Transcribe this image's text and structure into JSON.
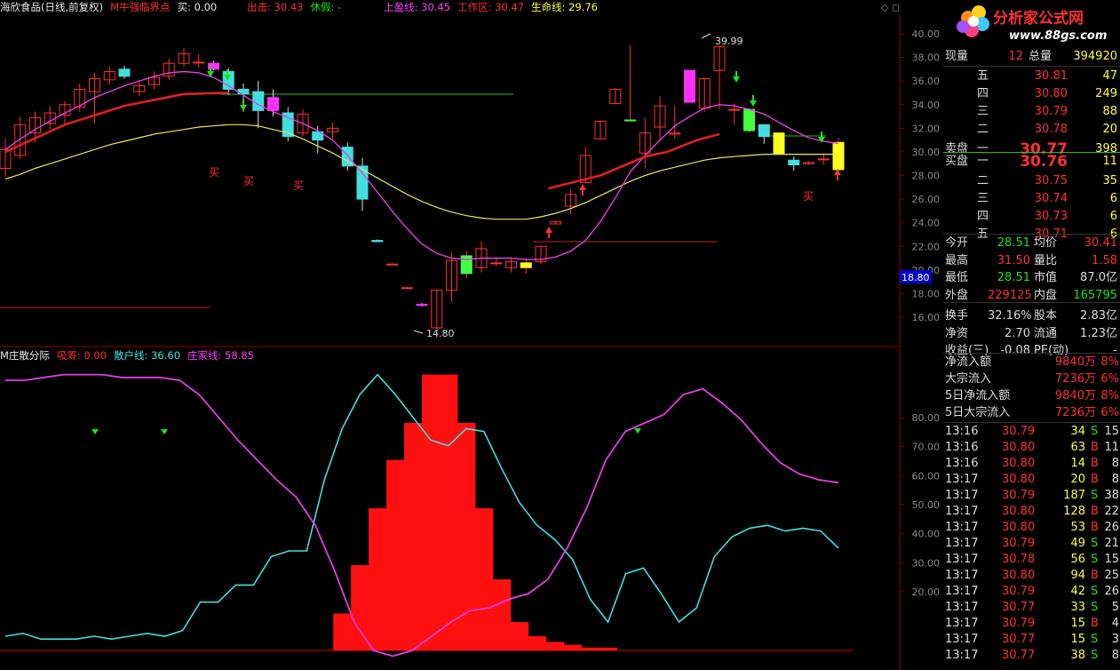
{
  "header": {
    "stock": "海欣食品(日线,前复权)",
    "indicator": "M牛强临界点",
    "buy": "买: 0.00",
    "sell_out": "出击: 30.43",
    "rest": "休假: -",
    "upper": "上盈线: 30.45",
    "work": "工作区: 30.47",
    "life": "生命线: 29.76"
  },
  "sub_header": {
    "name": "M庄散分际",
    "absorb": "吸筹: 0.00",
    "retail": "散户线: 36.60",
    "dealer": "庄家线: 58.85"
  },
  "logo": {
    "title": "分析家公式网",
    "url": "www.88gs.com"
  },
  "chart_data": [
    {
      "type": "candlestick",
      "yaxis_ticks": [
        "40.00",
        "38.00",
        "36.00",
        "34.00",
        "32.00",
        "30.00",
        "28.00",
        "26.00",
        "24.00",
        "22.00",
        "20.00",
        "18.00",
        "16.00"
      ],
      "ylim": [
        14.5,
        41
      ],
      "cursor_label": "18.80",
      "max_label": "39.99",
      "min_label": "14.80",
      "buy_labels": [
        "买",
        "买",
        "买",
        "买"
      ],
      "candles": [
        [
          28.6,
          31.1,
          27.9,
          30.2
        ],
        [
          29.7,
          33.0,
          29.4,
          32.3
        ],
        [
          31.6,
          33.4,
          30.8,
          32.9
        ],
        [
          32.4,
          33.9,
          31.9,
          33.3
        ],
        [
          33.1,
          34.3,
          32.4,
          34.0
        ],
        [
          33.8,
          35.8,
          33.4,
          35.3
        ],
        [
          35.1,
          36.7,
          32.4,
          36.2
        ],
        [
          36.1,
          37.2,
          35.7,
          36.8
        ],
        [
          37.0,
          37.3,
          36.2,
          36.4
        ],
        [
          35.1,
          35.9,
          34.7,
          35.6
        ],
        [
          35.7,
          36.8,
          35.3,
          36.3
        ],
        [
          36.4,
          37.9,
          36.1,
          37.5
        ],
        [
          37.5,
          38.8,
          37.2,
          38.3
        ],
        [
          37.6,
          38.3,
          37.1,
          37.6
        ],
        [
          37.5,
          37.7,
          36.9,
          37.0
        ],
        [
          36.8,
          37.1,
          34.8,
          35.3
        ],
        [
          35.3,
          35.8,
          33.4,
          34.9
        ],
        [
          35.1,
          36.0,
          32.0,
          33.5
        ],
        [
          34.6,
          35.3,
          33.0,
          33.5
        ],
        [
          33.3,
          33.8,
          30.9,
          31.3
        ],
        [
          31.6,
          33.6,
          31.3,
          33.2
        ],
        [
          31.7,
          32.2,
          29.9,
          31.0
        ],
        [
          31.7,
          32.5,
          31.1,
          32.0
        ],
        [
          30.4,
          30.8,
          28.4,
          28.8
        ],
        [
          28.8,
          29.5,
          25.0,
          26.0
        ],
        [
          22.5,
          22.6,
          22.4,
          22.4
        ],
        [
          20.5,
          20.6,
          20.4,
          20.5
        ],
        [
          18.5,
          18.6,
          18.4,
          18.5
        ],
        [
          17.1,
          17.2,
          16.9,
          17.0
        ],
        [
          15.1,
          18.3,
          14.8,
          18.3
        ],
        [
          18.3,
          21.5,
          17.3,
          20.8
        ],
        [
          19.7,
          21.6,
          19.3,
          21.2
        ],
        [
          20.2,
          22.4,
          19.8,
          21.8
        ],
        [
          20.6,
          21.1,
          20.3,
          20.6
        ],
        [
          20.2,
          21.0,
          19.8,
          20.7
        ],
        [
          20.2,
          21.0,
          19.7,
          20.6
        ],
        [
          20.7,
          22.0,
          20.5,
          22.0
        ],
        [
          23.9,
          24.1,
          23.9,
          24.1
        ],
        [
          25.4,
          26.8,
          24.7,
          26.4
        ],
        [
          27.4,
          30.4,
          27.4,
          29.7
        ],
        [
          31.1,
          32.6,
          31.1,
          32.6
        ],
        [
          34.1,
          35.4,
          34.1,
          35.3
        ],
        [
          32.7,
          39.0,
          32.7,
          32.7
        ],
        [
          29.9,
          32.9,
          28.6,
          31.6
        ],
        [
          32.1,
          34.7,
          31.1,
          33.9
        ],
        [
          31.5,
          33.9,
          31.1,
          31.6
        ],
        [
          34.2,
          36.9,
          34.2,
          36.9
        ],
        [
          33.7,
          36.2,
          33.4,
          36.2
        ],
        [
          36.9,
          38.9,
          33.6,
          38.9
        ],
        [
          33.6,
          34.1,
          32.3,
          33.6
        ],
        [
          33.6,
          33.7,
          31.7,
          31.8
        ],
        [
          32.3,
          32.3,
          30.7,
          31.3
        ],
        [
          31.6,
          31.6,
          29.8,
          29.8
        ],
        [
          29.3,
          29.6,
          28.4,
          28.9
        ],
        [
          29.0,
          29.2,
          28.9,
          29.1
        ],
        [
          29.4,
          29.8,
          28.9,
          29.4
        ],
        [
          28.5,
          31.2,
          28.4,
          30.8
        ]
      ],
      "ma_magenta": [
        30.2,
        31.1,
        31.9,
        32.6,
        33.3,
        33.9,
        34.6,
        35.1,
        35.6,
        36.0,
        36.4,
        36.7,
        36.8,
        36.7,
        36.3,
        35.6,
        34.8,
        34.0,
        33.4,
        32.9,
        32.4,
        31.8,
        31.0,
        29.7,
        28.2,
        26.6,
        25.0,
        23.5,
        22.2,
        21.4,
        21.0,
        20.9,
        21.0,
        21.0,
        21.0,
        20.9,
        20.9,
        21.1,
        21.6,
        22.5,
        24.1,
        26.1,
        28.3,
        29.7,
        31.0,
        32.2,
        33.0,
        33.7,
        34.0,
        33.9,
        33.6,
        33.2,
        32.5,
        31.8,
        31.2,
        30.9,
        30.7
      ],
      "ma_yellow": [
        27.7,
        28.1,
        28.6,
        29.0,
        29.4,
        29.8,
        30.2,
        30.6,
        30.9,
        31.2,
        31.5,
        31.7,
        31.9,
        32.1,
        32.2,
        32.3,
        32.3,
        32.2,
        31.9,
        31.6,
        31.1,
        30.5,
        29.9,
        29.2,
        28.5,
        27.8,
        27.1,
        26.4,
        25.8,
        25.3,
        24.9,
        24.6,
        24.4,
        24.3,
        24.3,
        24.3,
        24.5,
        24.8,
        25.2,
        25.7,
        26.3,
        26.9,
        27.5,
        28.0,
        28.4,
        28.7,
        29.0,
        29.3,
        29.5,
        29.6,
        29.7,
        29.8,
        29.8,
        29.8,
        29.8,
        29.8,
        29.8
      ],
      "ma_red": [
        [
          0,
          30.0
        ],
        [
          4,
          32.3
        ],
        [
          8,
          33.9
        ],
        [
          12,
          34.9
        ],
        [
          15,
          35.0
        ]
      ],
      "ma_red2": [
        [
          36.5,
          26.9
        ],
        [
          40,
          28.0
        ],
        [
          43,
          29.6
        ],
        [
          44.5,
          30.0
        ],
        [
          46.5,
          31.0
        ],
        [
          48,
          31.5
        ]
      ]
    },
    {
      "type": "line",
      "yaxis_ticks": [
        "80.00",
        "70.00",
        "60.00",
        "50.00",
        "40.00",
        "30.00",
        "20.00"
      ],
      "ylim": [
        -3,
        100
      ],
      "series": [
        {
          "name": "散户线",
          "values": [
            5,
            6,
            4,
            4,
            4,
            5,
            4,
            5,
            6,
            5,
            7,
            17,
            17,
            23,
            23,
            33,
            35,
            35,
            60,
            78,
            90,
            97,
            90,
            82,
            74,
            72,
            78,
            77,
            64,
            52,
            44,
            39,
            32,
            18,
            10,
            27,
            29,
            20,
            10,
            15,
            33,
            40,
            43,
            44,
            42,
            43,
            42,
            36
          ]
        },
        {
          "name": "庄家线",
          "values": [
            95,
            95,
            96,
            97,
            97,
            97,
            96,
            96,
            96,
            95,
            90,
            82,
            74,
            67,
            60,
            54,
            44,
            28,
            10,
            0,
            -2,
            0,
            5,
            10,
            14,
            15,
            18,
            20,
            25,
            36,
            50,
            67,
            77,
            80,
            83,
            90,
            92,
            87,
            81,
            73,
            66,
            62,
            60,
            59
          ]
        },
        {
          "name": "吸筹",
          "values": [
            0,
            0,
            0,
            0,
            0,
            0,
            0,
            0,
            0,
            0,
            0,
            0,
            0,
            0,
            0,
            0,
            0,
            0,
            0,
            13,
            30,
            50,
            67,
            80,
            97,
            97,
            80,
            50,
            25,
            10,
            5,
            3,
            2,
            1,
            1,
            0,
            0,
            0,
            0,
            0,
            0,
            0,
            0,
            0,
            0,
            0,
            0,
            0
          ]
        }
      ]
    }
  ],
  "quote": {
    "xianliang_label": "现量",
    "xianliang": "12",
    "zongliang_label": "总量",
    "zongliang": "394920",
    "sell": [
      {
        "label": "五",
        "price": "30.81",
        "vol": "47"
      },
      {
        "label": "四",
        "price": "30.80",
        "vol": "249"
      },
      {
        "label": "三",
        "price": "30.79",
        "vol": "88"
      },
      {
        "label": "二",
        "price": "30.78",
        "vol": "20"
      },
      {
        "label": "一",
        "price": "30.77",
        "vol": "398"
      }
    ],
    "sell_title": "卖盘",
    "buy_title": "买盘",
    "buy": [
      {
        "label": "一",
        "price": "30.76",
        "vol": "11"
      },
      {
        "label": "二",
        "price": "30.75",
        "vol": "35"
      },
      {
        "label": "三",
        "price": "30.74",
        "vol": "6"
      },
      {
        "label": "四",
        "price": "30.73",
        "vol": "6"
      },
      {
        "label": "五",
        "price": "30.71",
        "vol": "6"
      }
    ],
    "stats": [
      [
        "今开",
        "28.51",
        "均价",
        "30.41"
      ],
      [
        "最高",
        "31.50",
        "量比",
        "1.58"
      ],
      [
        "最低",
        "28.51",
        "市值",
        "87.0亿"
      ],
      [
        "外盘",
        "229125",
        "内盘",
        "165795"
      ],
      [
        "换手",
        "32.16%",
        "股本",
        "2.83亿"
      ],
      [
        "净资",
        "2.70",
        "流通",
        "1.23亿"
      ],
      [
        "收益(三)",
        "-0.08",
        "PE(动)",
        "-"
      ]
    ],
    "flows": [
      [
        "净流入额",
        "9840万",
        "8%"
      ],
      [
        "大宗流入",
        "7236万",
        "6%"
      ],
      [
        "5日净流入额",
        "9840万",
        "8%"
      ],
      [
        "5日大宗流入",
        "7236万",
        "6%"
      ]
    ],
    "ticks": [
      [
        "13:16",
        "30.79",
        "34",
        "S",
        "15"
      ],
      [
        "13:16",
        "30.80",
        "63",
        "B",
        "11"
      ],
      [
        "13:16",
        "30.80",
        "14",
        "B",
        "8"
      ],
      [
        "13:17",
        "30.80",
        "20",
        "B",
        "8"
      ],
      [
        "13:17",
        "30.79",
        "187",
        "S",
        "38"
      ],
      [
        "13:17",
        "30.80",
        "128",
        "B",
        "22"
      ],
      [
        "13:17",
        "30.80",
        "53",
        "B",
        "26"
      ],
      [
        "13:17",
        "30.79",
        "49",
        "S",
        "21"
      ],
      [
        "13:17",
        "30.78",
        "56",
        "S",
        "15"
      ],
      [
        "13:17",
        "30.80",
        "94",
        "B",
        "25"
      ],
      [
        "13:17",
        "30.79",
        "42",
        "S",
        "26"
      ],
      [
        "13:17",
        "30.77",
        "33",
        "S",
        "5"
      ],
      [
        "13:17",
        "30.79",
        "15",
        "B",
        "4"
      ],
      [
        "13:17",
        "30.77",
        "15",
        "S",
        "3"
      ],
      [
        "13:17",
        "30.77",
        "38",
        "S",
        "8"
      ]
    ]
  }
}
